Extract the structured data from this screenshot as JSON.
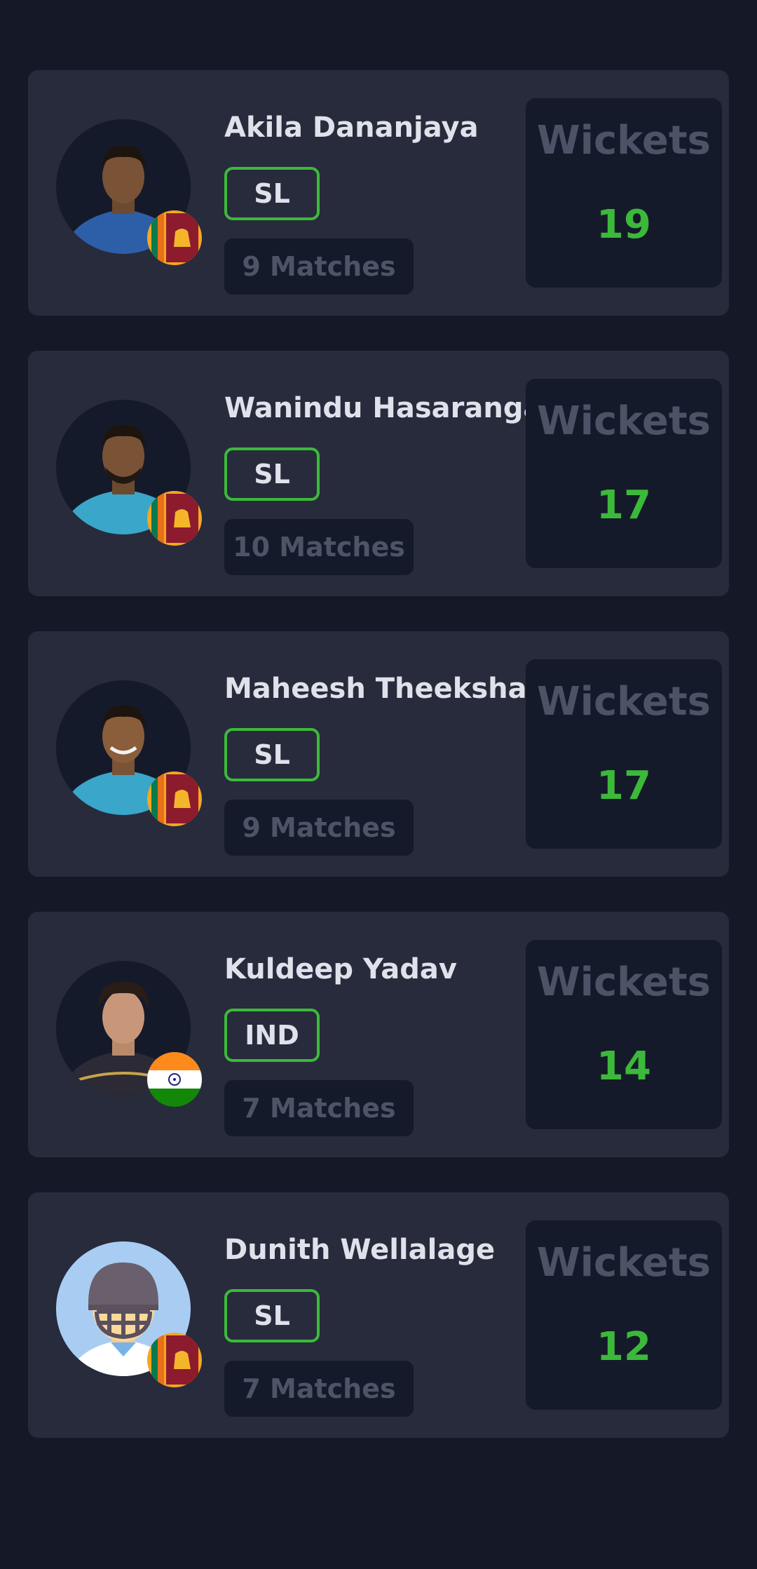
{
  "colors": {
    "background": "#141827",
    "card": "#272b3c",
    "accent_green": "#3cb93a",
    "muted_text": "#4e5468"
  },
  "players": [
    {
      "name": "Akila Dananjaya",
      "team": "SL",
      "matches": "9 Matches",
      "stat_label": "Wickets",
      "stat_value": "19",
      "flag": "sri-lanka-flag-icon",
      "avatar": "player-photo"
    },
    {
      "name": "Wanindu Hasaranga",
      "team": "SL",
      "matches": "10 Matches",
      "stat_label": "Wickets",
      "stat_value": "17",
      "flag": "sri-lanka-flag-icon",
      "avatar": "player-photo"
    },
    {
      "name": "Maheesh Theekshana",
      "team": "SL",
      "matches": "9 Matches",
      "stat_label": "Wickets",
      "stat_value": "17",
      "flag": "sri-lanka-flag-icon",
      "avatar": "player-photo"
    },
    {
      "name": "Kuldeep Yadav",
      "team": "IND",
      "matches": "7 Matches",
      "stat_label": "Wickets",
      "stat_value": "14",
      "flag": "india-flag-icon",
      "avatar": "player-photo"
    },
    {
      "name": "Dunith Wellalage",
      "team": "SL",
      "matches": "7 Matches",
      "stat_label": "Wickets",
      "stat_value": "12",
      "flag": "sri-lanka-flag-icon",
      "avatar": "player-placeholder-icon"
    }
  ]
}
